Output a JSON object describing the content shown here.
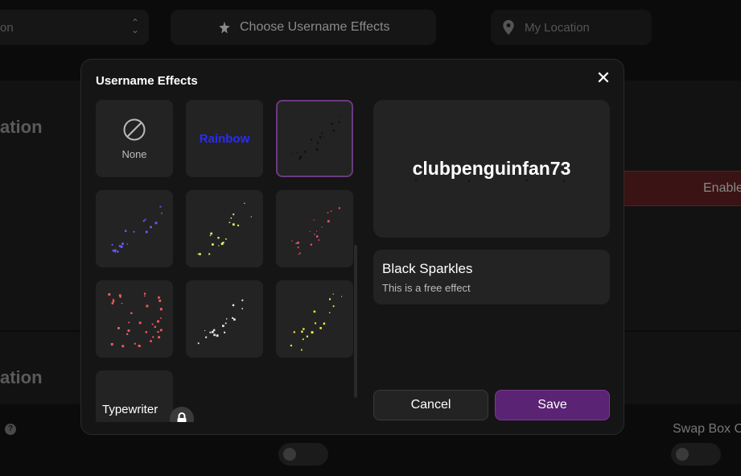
{
  "background": {
    "select_text": "on",
    "effects_button_label": "Choose Username Effects",
    "location_placeholder": "My Location",
    "heading_1": "ation",
    "heading_2": "ation",
    "enable_label": "Enable",
    "swap_label": "Swap Box C"
  },
  "modal": {
    "title": "Username Effects",
    "close_icon": "close-icon",
    "tiles": [
      {
        "label": "None"
      },
      {
        "label": "Rainbow"
      },
      {
        "label": "",
        "color": "#111111"
      },
      {
        "label": "",
        "color": "#6a5cff"
      },
      {
        "label": "",
        "color": "#e8f26a"
      },
      {
        "label": "",
        "color": "#ff4d6a"
      },
      {
        "label": "",
        "color": "#ff5a5a"
      },
      {
        "label": "",
        "color": "#e8e8e8"
      },
      {
        "label": "",
        "color": "#f2f23a"
      },
      {
        "label": "Typewriter"
      }
    ],
    "preview": {
      "username": "clubpenguinfan73"
    },
    "effect_info": {
      "name": "Black Sparkles",
      "description": "This is a free effect"
    },
    "cancel_label": "Cancel",
    "save_label": "Save",
    "accent_color": "#5a2373"
  }
}
